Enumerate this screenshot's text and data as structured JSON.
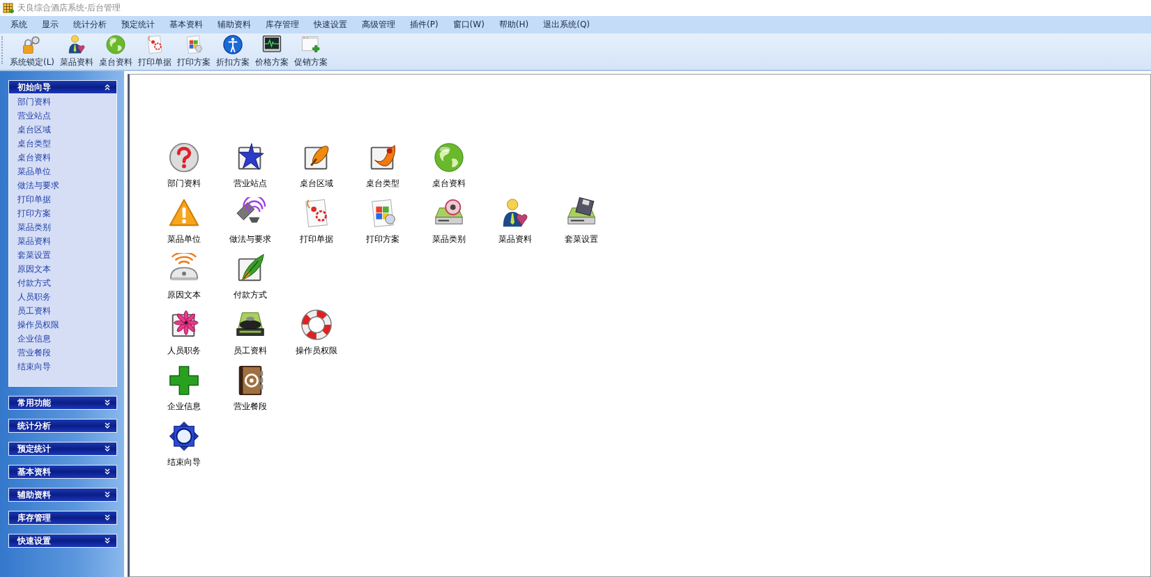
{
  "window": {
    "title": "天良综合酒店系统-后台管理"
  },
  "menu": [
    "系统",
    "显示",
    "统计分析",
    "预定统计",
    "基本资料",
    "辅助资料",
    "库存管理",
    "快速设置",
    "高级管理",
    "插件(P)",
    "窗口(W)",
    "帮助(H)",
    "退出系统(Q)"
  ],
  "toolbar": [
    {
      "label": "系统锁定(L)",
      "kind": "lock"
    },
    {
      "label": "菜品资料",
      "kind": "person"
    },
    {
      "label": "桌台资料",
      "kind": "globe"
    },
    {
      "label": "打印单据",
      "kind": "clipdoc"
    },
    {
      "label": "打印方案",
      "kind": "windoc"
    },
    {
      "label": "折扣方案",
      "kind": "info"
    },
    {
      "label": "价格方案",
      "kind": "monitor"
    },
    {
      "label": "促销方案",
      "kind": "winplus"
    }
  ],
  "sidebar": {
    "sections": [
      {
        "title": "初始向导",
        "expanded": true,
        "items": [
          "部门资料",
          "营业站点",
          "桌台区域",
          "桌台类型",
          "桌台资料",
          "菜品单位",
          "做法与要求",
          "打印单据",
          "打印方案",
          "菜品类别",
          "菜品资料",
          "套菜设置",
          "原因文本",
          "付款方式",
          "人员职务",
          "员工资料",
          "操作员权限",
          "企业信息",
          "营业餐段",
          "结束向导"
        ]
      },
      {
        "title": "常用功能",
        "expanded": false
      },
      {
        "title": "统计分析",
        "expanded": false
      },
      {
        "title": "预定统计",
        "expanded": false
      },
      {
        "title": "基本资料",
        "expanded": false
      },
      {
        "title": "辅助资料",
        "expanded": false
      },
      {
        "title": "库存管理",
        "expanded": false
      },
      {
        "title": "快速设置",
        "expanded": false
      }
    ]
  },
  "launchers": {
    "rows": [
      [
        {
          "label": "部门资料",
          "kind": "question"
        },
        {
          "label": "营业站点",
          "kind": "star"
        },
        {
          "label": "桌台区域",
          "kind": "brush"
        },
        {
          "label": "桌台类型",
          "kind": "brush2"
        },
        {
          "label": "桌台资料",
          "kind": "globe"
        }
      ],
      [
        {
          "label": "菜品单位",
          "kind": "warning"
        },
        {
          "label": "做法与要求",
          "kind": "speaker"
        },
        {
          "label": "打印单据",
          "kind": "clipdoc"
        },
        {
          "label": "打印方案",
          "kind": "windoc"
        },
        {
          "label": "菜品类别",
          "kind": "discdrive"
        },
        {
          "label": "菜品资料",
          "kind": "person"
        },
        {
          "label": "套菜设置",
          "kind": "floppydrive"
        }
      ],
      [
        {
          "label": "原因文本",
          "kind": "wireless"
        },
        {
          "label": "付款方式",
          "kind": "feather"
        }
      ],
      [
        {
          "label": "人员职务",
          "kind": "flower"
        },
        {
          "label": "员工资料",
          "kind": "drive"
        },
        {
          "label": "操作员权限",
          "kind": "lifebuoy"
        }
      ],
      [
        {
          "label": "企业信息",
          "kind": "plus"
        },
        {
          "label": "营业餐段",
          "kind": "book"
        }
      ],
      [
        {
          "label": "结束向导",
          "kind": "badge"
        }
      ]
    ]
  }
}
